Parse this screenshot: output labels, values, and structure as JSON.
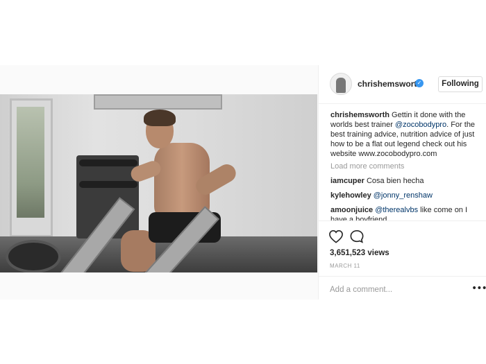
{
  "post": {
    "header": {
      "username": "chrishemsworth",
      "verified_icon": "verified-badge-icon",
      "follow_label": "Following"
    },
    "caption": {
      "username": "chrishemsworth",
      "text_before": "Gettin it done with the worlds best trainer",
      "mention": "@zocobodypro",
      "text_after": ". For the best training advice, nutrition advice of just how to be a flat out legend check out his website www.zocobodypro.com"
    },
    "load_more": "Load more comments",
    "comments": [
      {
        "username": "iamcuper",
        "text": "Cosa bien hecha",
        "mention": ""
      },
      {
        "username": "kylehowley",
        "text": "",
        "mention": "@jonny_renshaw"
      },
      {
        "username": "amoonjuice",
        "text": "like come on I have a boyfriend",
        "mention": "@therealvbs"
      }
    ],
    "actions": {
      "like_icon": "heart-icon",
      "comment_icon": "comment-bubble-icon"
    },
    "views": "3,651,523 views",
    "date": "MARCH 11",
    "add_comment_placeholder": "Add a comment...",
    "more_icon": "ellipsis-icon",
    "more_text": "•••"
  },
  "colors": {
    "link": "#003569",
    "muted": "#999999",
    "verified": "#3897f0",
    "text": "#262626",
    "border": "#efefef"
  }
}
